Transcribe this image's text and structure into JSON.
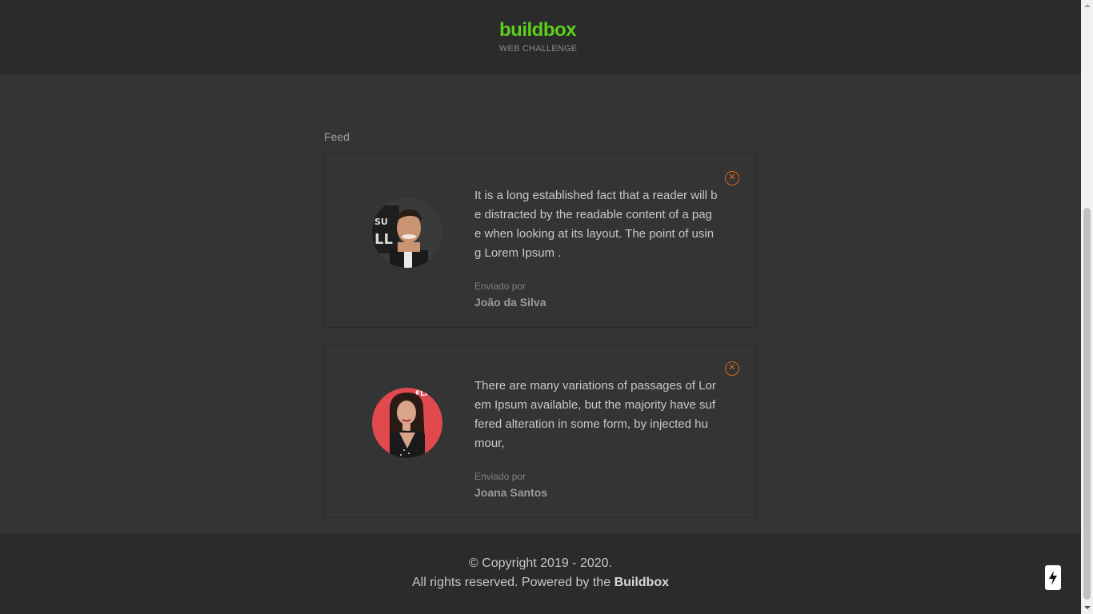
{
  "header": {
    "brand": "buildbox",
    "subtitle": "WEB CHALLENGE"
  },
  "feed": {
    "title": "Feed",
    "posts": [
      {
        "message": "It is a long established fact that a reader will be distracted by the readable content of a page when looking at its layout. The point of using Lorem Ipsum .",
        "sent_label": "Enviado por",
        "author": "João da Silva",
        "avatar_icon": "man-portrait-avatar"
      },
      {
        "message": "There are many variations of passages of Lorem Ipsum available, but the majority have suffered alteration in some form, by injected humour,",
        "sent_label": "Enviado por",
        "author": "Joana Santos",
        "avatar_icon": "woman-portrait-avatar"
      }
    ],
    "close_icon": "close-circle-icon"
  },
  "footer": {
    "line1": "© Copyright 2019 - 2020.",
    "line2_prefix": "All rights reserved. Powered by the",
    "line2_brand": "Buildbox"
  },
  "widgets": {
    "bolt_icon": "lightning-bolt-icon"
  },
  "colors": {
    "brand": "#5dcf1a",
    "accent": "#d2691e",
    "background": "#343434",
    "header_footer": "#2b2b2b"
  }
}
